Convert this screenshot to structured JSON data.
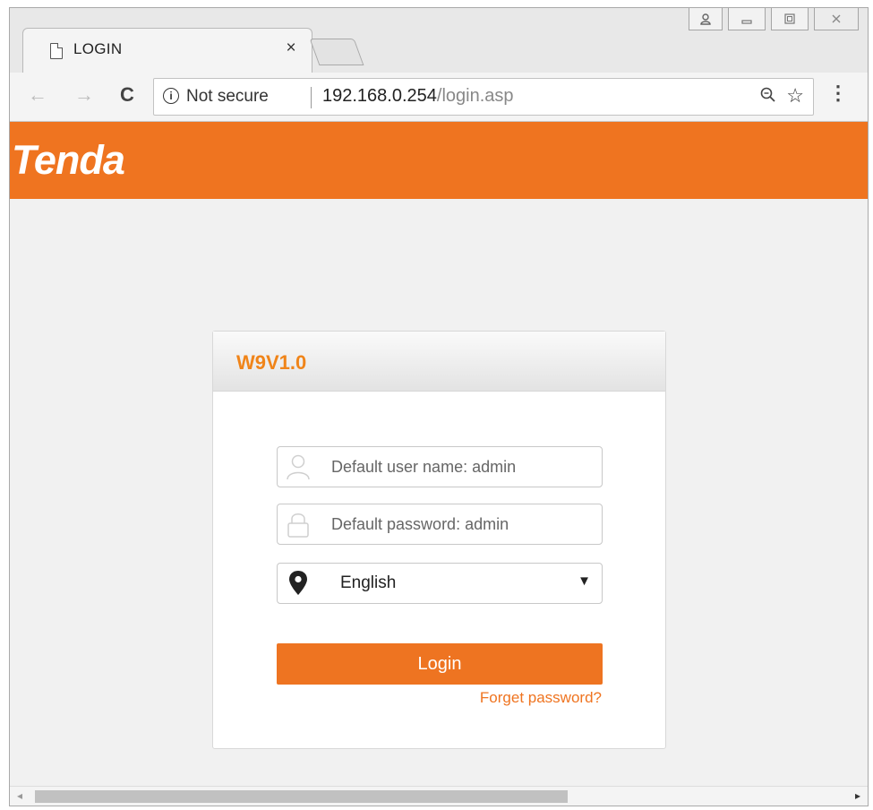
{
  "browser": {
    "tab_title": "LOGIN",
    "tab_close": "×",
    "security_label": "Not secure",
    "url_host": "192.168.0.254",
    "url_path": "/login.asp"
  },
  "brand": {
    "logo_text": "Tenda",
    "color": "#ef7420"
  },
  "login": {
    "model": "W9V1.0",
    "username_placeholder": "Default user name: admin",
    "password_placeholder": "Default password: admin",
    "language_value": "English",
    "login_label": "Login",
    "forget_label": "Forget password?"
  },
  "scroll": {
    "thumb_fraction": 0.62
  }
}
